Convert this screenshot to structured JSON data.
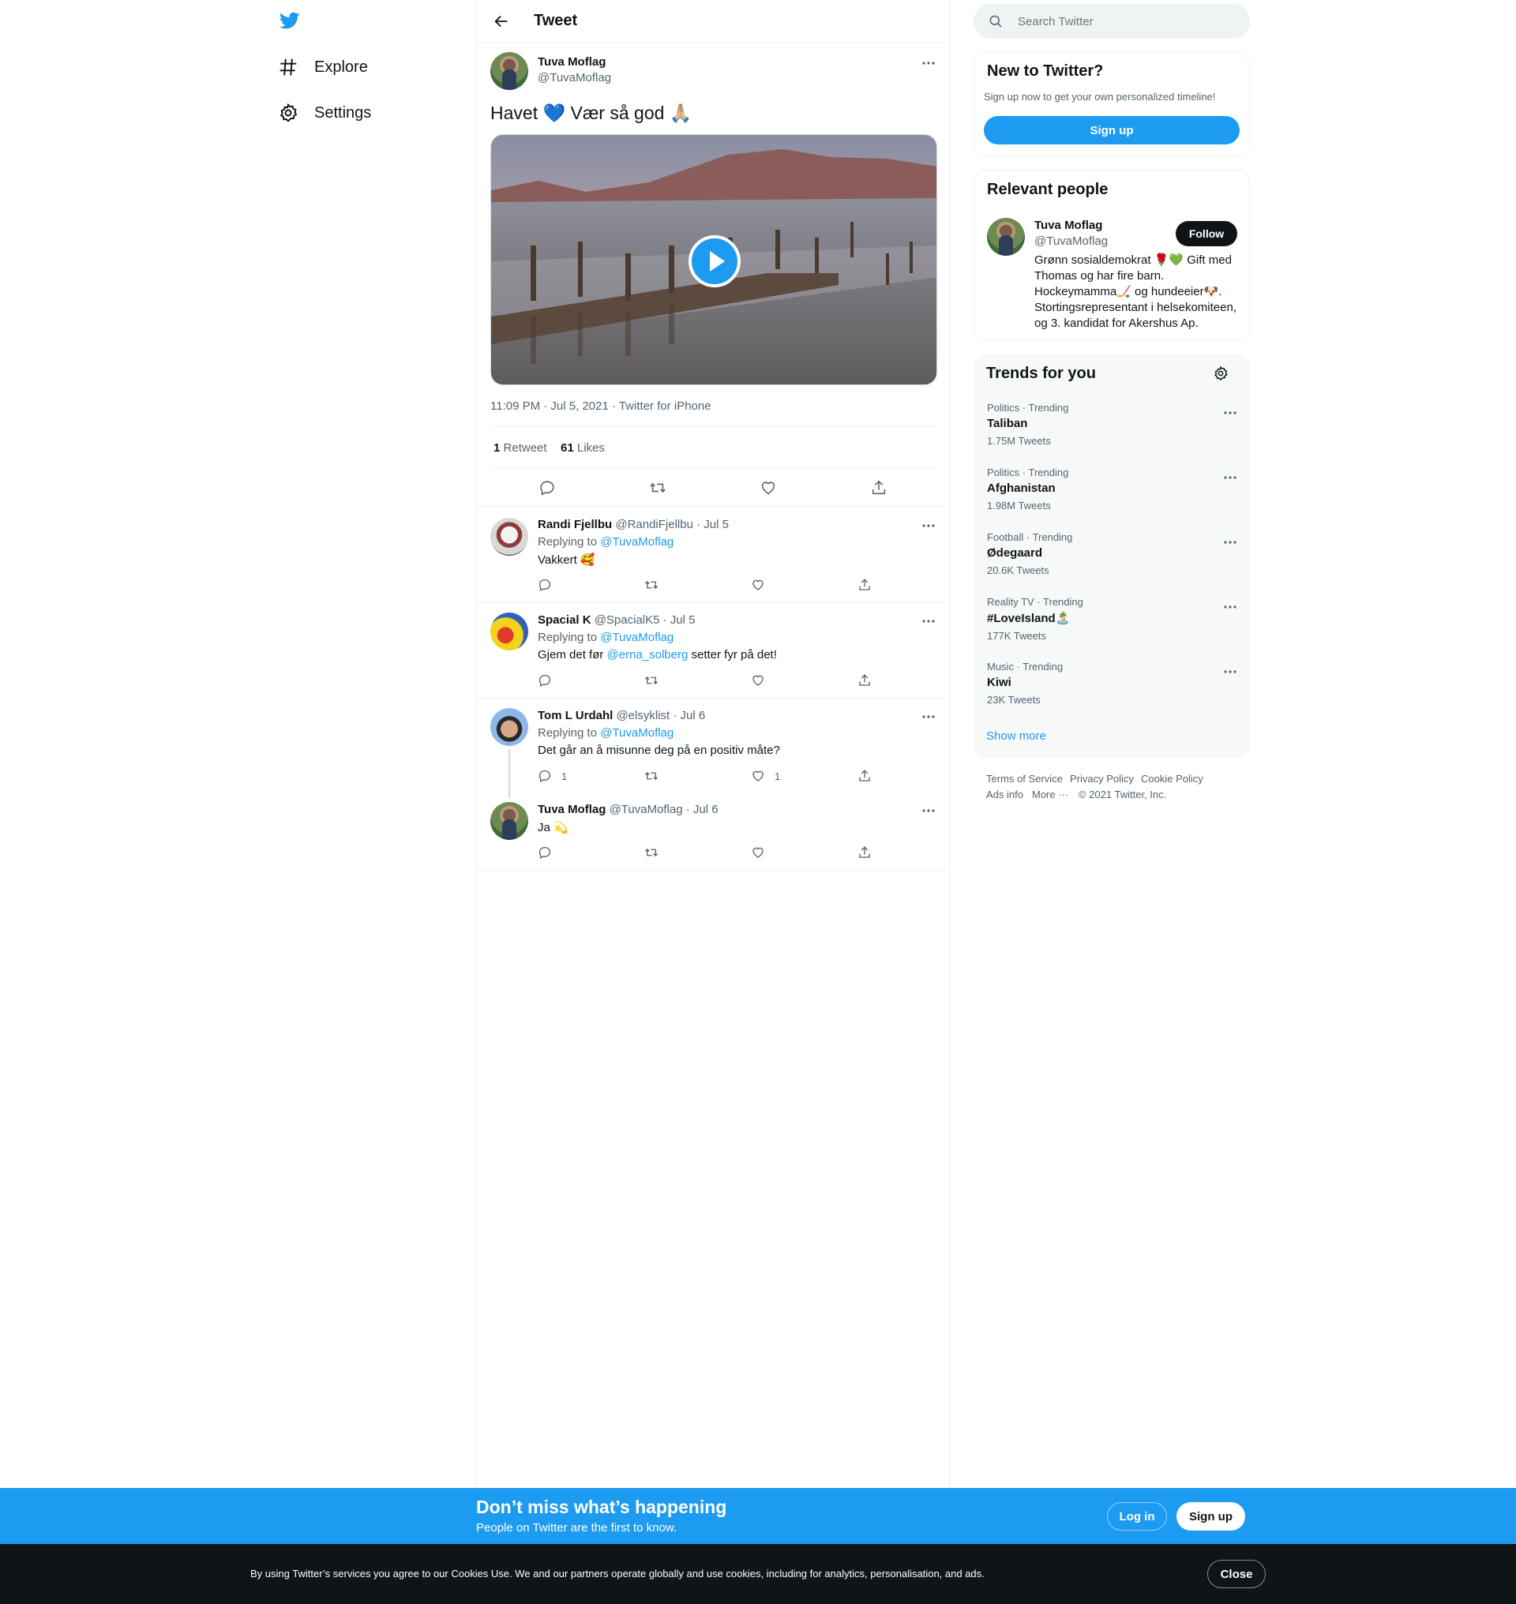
{
  "nav": {
    "explore": "Explore",
    "settings": "Settings"
  },
  "header": {
    "title": "Tweet"
  },
  "tweet": {
    "author_name": "Tuva Moflag",
    "author_handle": "@TuvaMoflag",
    "text": "Havet 💙 Vær så god 🙏🏼",
    "timestamp": "11:09 PM · Jul 5, 2021 · Twitter for iPhone",
    "retweet_count": "1",
    "retweet_label": "Retweet",
    "like_count": "61",
    "like_label": "Likes"
  },
  "replies": [
    {
      "name": "Randi Fjellbu",
      "meta": "@RandiFjellbu · Jul 5",
      "replying_prefix": "Replying to",
      "replying_to": "@TuvaMoflag",
      "text": "Vakkert 🥰",
      "reply_count": "",
      "like_count": ""
    },
    {
      "name": "Spacial K",
      "meta": "@SpacialK5 · Jul 5",
      "replying_prefix": "Replying to",
      "replying_to": "@TuvaMoflag",
      "text_before": "Gjem det før",
      "mention": "@erna_solberg",
      "text_after": "setter fyr på det!",
      "reply_count": "",
      "like_count": ""
    },
    {
      "name": "Tom L Urdahl",
      "meta": "@elsyklist · Jul 6",
      "replying_prefix": "Replying to",
      "replying_to": "@TuvaMoflag",
      "text": "Det går an å misunne deg på en positiv måte?",
      "reply_count": "1",
      "like_count": "1"
    },
    {
      "name": "Tuva Moflag",
      "meta": "@TuvaMoflag · Jul 6",
      "text": "Ja 💫",
      "reply_count": "",
      "like_count": ""
    }
  ],
  "search": {
    "placeholder": "Search Twitter"
  },
  "new_to_twitter": {
    "title": "New to Twitter?",
    "subtitle": "Sign up now to get your own personalized timeline!",
    "button": "Sign up"
  },
  "relevant_people": {
    "title": "Relevant people",
    "name": "Tuva Moflag",
    "handle": "@TuvaMoflag",
    "follow_button": "Follow",
    "bio": "Grønn sosialdemokrat 🌹💚 Gift med Thomas og har fire barn. Hockeymamma🏒 og hundeeier🐶. Stortingsrepresentant i helsekomiteen, og 3. kandidat for Akershus Ap."
  },
  "trends": {
    "title": "Trends for you",
    "items": [
      {
        "category": "Politics · Trending",
        "name": "Taliban",
        "count": "1.75M Tweets"
      },
      {
        "category": "Politics · Trending",
        "name": "Afghanistan",
        "count": "1.98M Tweets"
      },
      {
        "category": "Football · Trending",
        "name": "Ødegaard",
        "count": "20.6K Tweets"
      },
      {
        "category": "Reality TV · Trending",
        "name": "#LoveIsland🏝️",
        "count": "177K Tweets"
      },
      {
        "category": "Music · Trending",
        "name": "Kiwi",
        "count": "23K Tweets"
      }
    ],
    "show_more": "Show more"
  },
  "footer": {
    "terms": "Terms of Service",
    "privacy": "Privacy Policy",
    "cookie": "Cookie Policy",
    "ads": "Ads info",
    "more": "More ···",
    "copyright": "© 2021 Twitter, Inc."
  },
  "signup_bar": {
    "headline": "Don’t miss what’s happening",
    "subline": "People on Twitter are the first to know.",
    "login": "Log in",
    "signup": "Sign up"
  },
  "cookie_bar": {
    "text": "By using Twitter’s services you agree to our Cookies Use. We and our partners operate globally and use cookies, including for analytics, personalisation, and ads.",
    "close": "Close"
  },
  "colors": {
    "accent": "#1d9bf0",
    "text": "#0f1419",
    "muted": "#536471",
    "dark": "#0f1419"
  }
}
